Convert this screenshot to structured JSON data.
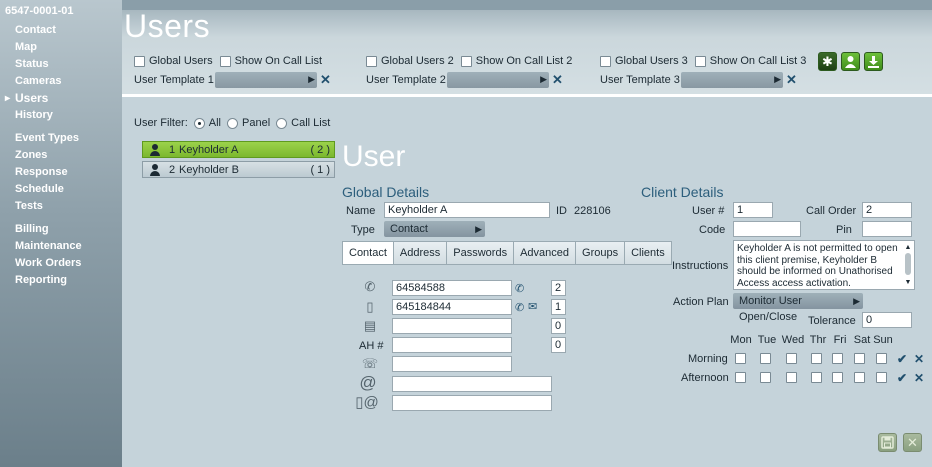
{
  "sidebar": {
    "account_id": "6547-0001-01",
    "items": [
      {
        "label": "Contact"
      },
      {
        "label": "Map"
      },
      {
        "label": "Status"
      },
      {
        "label": "Cameras"
      },
      {
        "label": "Users"
      },
      {
        "label": "History"
      },
      {
        "label": "Event Types"
      },
      {
        "label": "Zones"
      },
      {
        "label": "Response"
      },
      {
        "label": "Schedule"
      },
      {
        "label": "Tests"
      },
      {
        "label": "Billing"
      },
      {
        "label": "Maintenance"
      },
      {
        "label": "Work Orders"
      },
      {
        "label": "Reporting"
      }
    ],
    "active": "Users"
  },
  "header": {
    "title": "Users",
    "groups": [
      {
        "global_label": "Global Users",
        "call_list_label": "Show On Call List",
        "template_label": "User Template 1",
        "template_value": ""
      },
      {
        "global_label": "Global Users 2",
        "call_list_label": "Show On Call List 2",
        "template_label": "User Template 2",
        "template_value": ""
      },
      {
        "global_label": "Global Users 3",
        "call_list_label": "Show On Call List 3",
        "template_label": "User Template 3",
        "template_value": ""
      }
    ],
    "toolbar": {
      "new_icon": "asterisk-icon",
      "user_icon": "person-icon",
      "download_icon": "download-icon"
    }
  },
  "filter": {
    "label": "User Filter:",
    "options": [
      {
        "label": "All",
        "checked": true
      },
      {
        "label": "Panel",
        "checked": false
      },
      {
        "label": "Call List",
        "checked": false
      }
    ]
  },
  "keyholders": [
    {
      "num": "1",
      "name": "Keyholder A",
      "count": "( 2 )",
      "selected": true
    },
    {
      "num": "2",
      "name": "Keyholder B",
      "count": "( 1 )",
      "selected": false
    }
  ],
  "user": {
    "title": "User",
    "global_details_title": "Global Details",
    "name_label": "Name",
    "name_value": "Keyholder A",
    "id_label": "ID",
    "id_value": "228106",
    "type_label": "Type",
    "type_value": "Contact",
    "tabs": [
      "Contact",
      "Address",
      "Passwords",
      "Advanced",
      "Groups",
      "Clients"
    ],
    "active_tab": "Contact",
    "contacts": {
      "phone": "64584588",
      "phone_order": "2",
      "mobile": "645184844",
      "mobile_order": "1",
      "fax": "",
      "fax_order": "0",
      "ah_label": "AH #",
      "ah": "",
      "ah_order": "0",
      "pager": "",
      "email": "",
      "sms_email": ""
    }
  },
  "client": {
    "title": "Client Details",
    "user_num_label": "User #",
    "user_num_value": "1",
    "call_order_label": "Call Order",
    "call_order_value": "2",
    "code_label": "Code",
    "code_value": "",
    "pin_label": "Pin",
    "pin_value": "",
    "instructions_label": "Instructions",
    "instructions_text": "Keyholder A is not permitted to open this client premise, Keyholder B should be informed on Unathorised Access access activation.",
    "action_plan_label": "Action Plan",
    "action_plan_value": "Monitor User Open/Close",
    "tolerance_label": "Tolerance",
    "tolerance_value": "0",
    "days": [
      "Mon",
      "Tue",
      "Wed",
      "Thr",
      "Fri",
      "Sat",
      "Sun"
    ],
    "morning_label": "Morning",
    "afternoon_label": "Afternoon"
  },
  "footer": {
    "save_icon": "save-icon",
    "close_icon": "close-icon"
  }
}
